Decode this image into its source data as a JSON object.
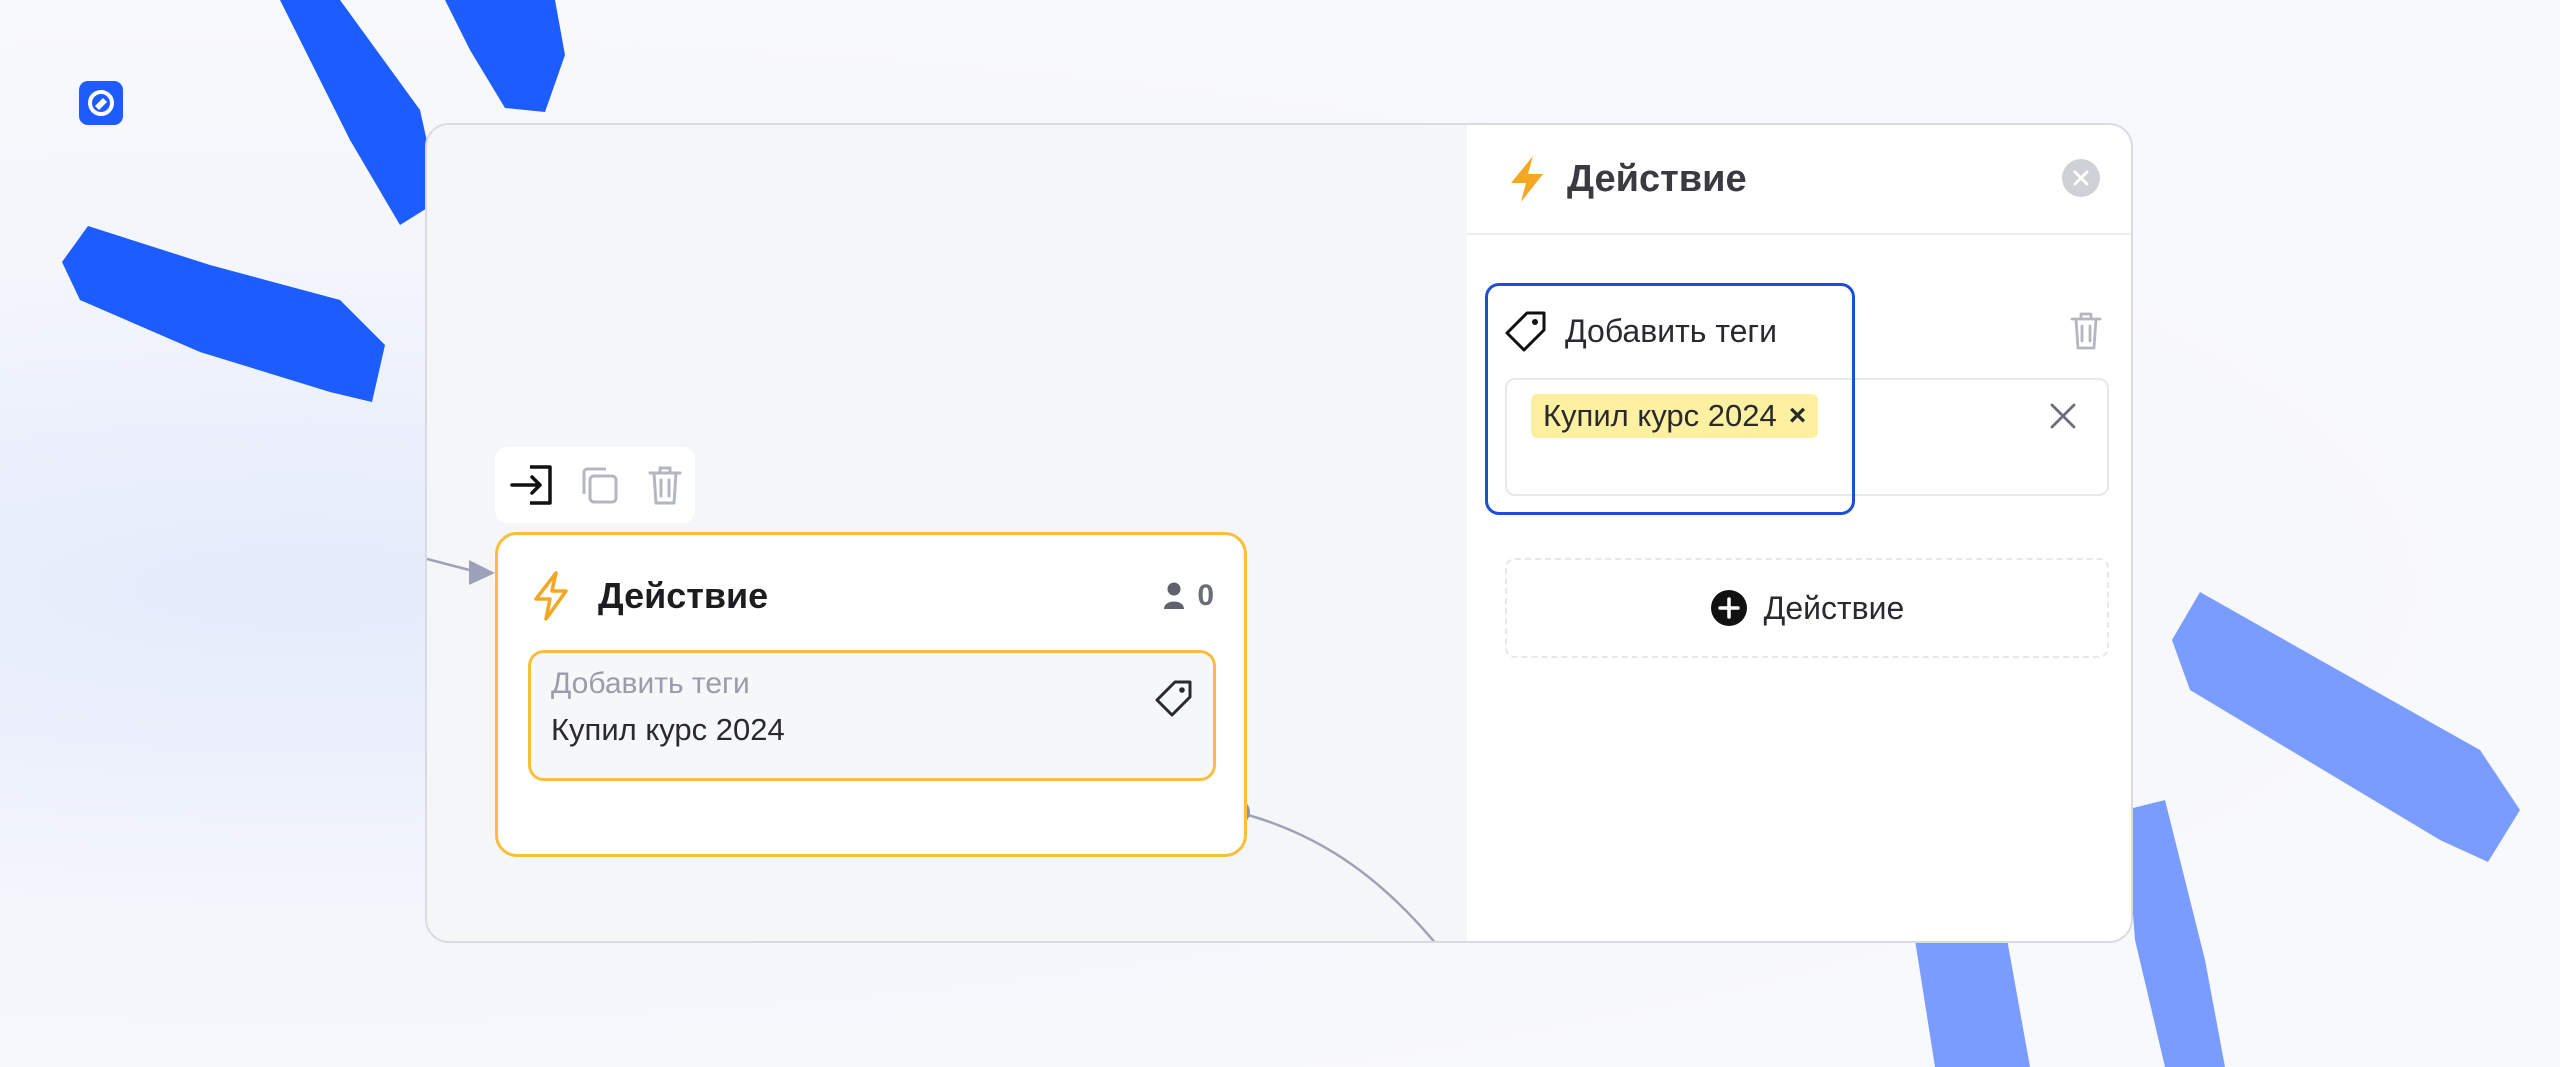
{
  "colors": {
    "brand": "#1d5cff",
    "node_border": "#fbbd3c",
    "lightning": "#f5a623",
    "tag_chip": "#fdf0a0",
    "highlight": "#1d4ed8"
  },
  "logo": {
    "icon": "brand-logo-icon"
  },
  "canvas": {
    "toolbar": {
      "items": [
        {
          "icon": "enter-icon"
        },
        {
          "icon": "copy-icon"
        },
        {
          "icon": "trash-icon"
        }
      ]
    },
    "node": {
      "icon": "lightning-icon",
      "title": "Действие",
      "count_icon": "user-icon",
      "count": "0",
      "step": {
        "label": "Добавить теги",
        "value": "Купил курс 2024",
        "icon": "tag-icon"
      }
    }
  },
  "panel": {
    "icon": "lightning-icon",
    "title": "Действие",
    "close_icon": "close-icon",
    "tag_block": {
      "icon": "tag-icon",
      "title": "Добавить теги",
      "delete_icon": "trash-icon",
      "tags": [
        {
          "label": "Купил курс 2024",
          "remove": "×"
        }
      ],
      "clear_icon": "close-icon"
    },
    "add_action": {
      "icon": "plus-circle-icon",
      "label": "Действие"
    }
  }
}
